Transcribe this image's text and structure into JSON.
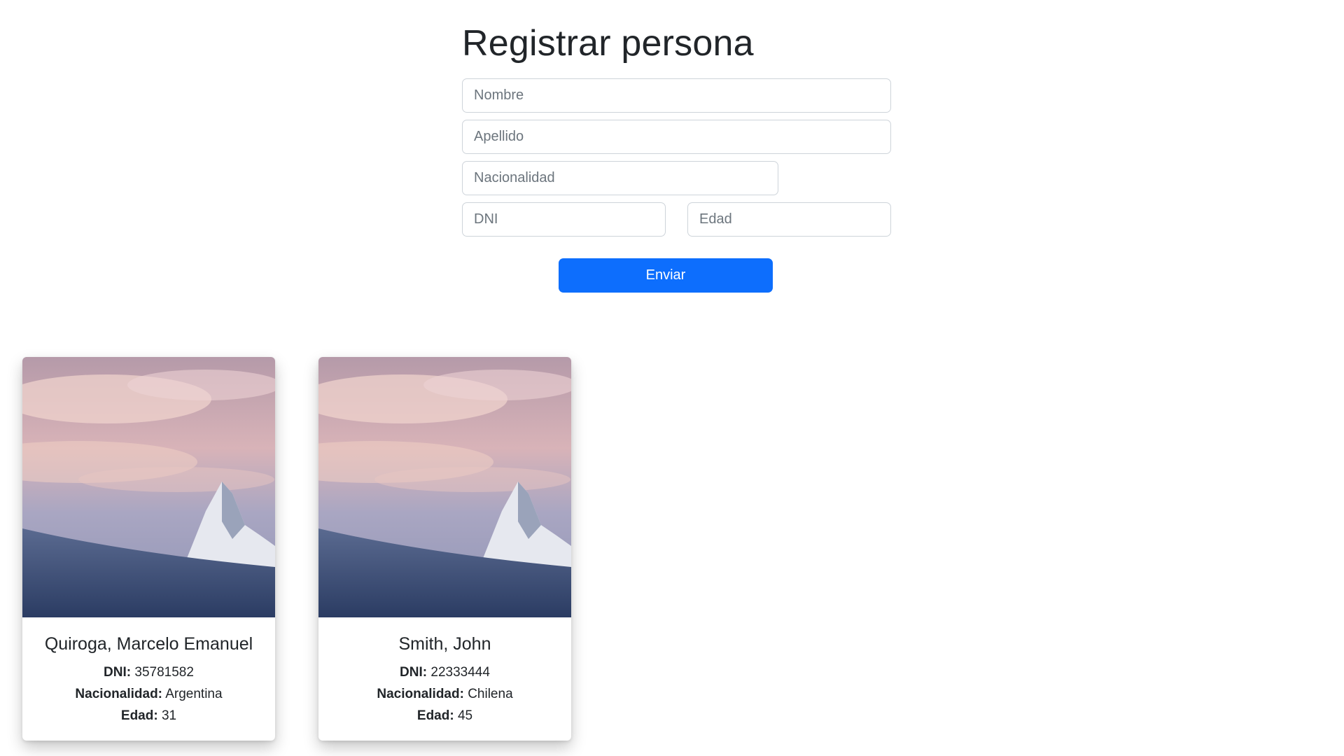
{
  "form": {
    "title": "Registrar persona",
    "nombre_placeholder": "Nombre",
    "apellido_placeholder": "Apellido",
    "nacionalidad_placeholder": "Nacionalidad",
    "dni_placeholder": "DNI",
    "edad_placeholder": "Edad",
    "submit_label": "Enviar"
  },
  "labels": {
    "dni": "DNI:",
    "nacionalidad": "Nacionalidad:",
    "edad": "Edad:"
  },
  "people": [
    {
      "name": "Quiroga, Marcelo Emanuel",
      "dni": "35781582",
      "nacionalidad": "Argentina",
      "edad": "31"
    },
    {
      "name": "Smith, John",
      "dni": "22333444",
      "nacionalidad": "Chilena",
      "edad": "45"
    }
  ],
  "colors": {
    "primary": "#0d6efd",
    "text": "#212529",
    "border": "#ced4da"
  }
}
